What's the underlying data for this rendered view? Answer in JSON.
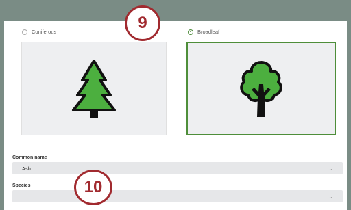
{
  "tree_type": {
    "options": [
      {
        "label": "Coniferous",
        "selected": false,
        "icon": "conifer-tree-icon"
      },
      {
        "label": "Broadleaf",
        "selected": true,
        "icon": "broadleaf-tree-icon"
      }
    ]
  },
  "fields": {
    "common_name": {
      "label": "Common name",
      "value": "Ash"
    },
    "species": {
      "label": "Species",
      "value": ""
    }
  },
  "callouts": {
    "first": "9",
    "second": "10"
  },
  "colors": {
    "accent": "#4e8e3a",
    "tree_green": "#4caf3f",
    "callout": "#a12a2f"
  }
}
